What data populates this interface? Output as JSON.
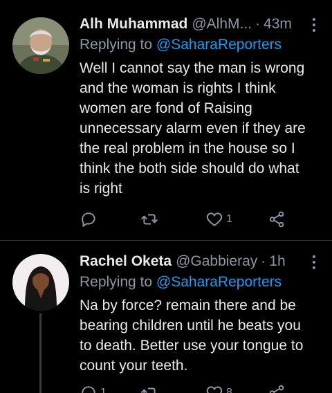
{
  "tweets": [
    {
      "name": "Alh Muhammad",
      "handle": "@AlhM...",
      "time": "43m",
      "replying_prefix": "Replying to ",
      "replying_to": "@SaharaReporters",
      "lines": [
        "Well I cannot say the man is wrong",
        "and the woman is rights I think",
        "women are fond of Raising",
        "unnecessary alarm even if they are",
        "the real problem in the house so I",
        "think the both side should do what",
        "is right"
      ],
      "reply_count": "",
      "retweet_count": "",
      "like_count": "1"
    },
    {
      "name": "Rachel Oketa",
      "handle": "@Gabbieray",
      "time": "1h",
      "replying_prefix": "Replying to ",
      "replying_to": "@SaharaReporters",
      "lines": [
        "Na by force? remain there and be",
        "bearing children until he beats you",
        "to death. Better use your tongue to",
        "count your teeth."
      ],
      "reply_count": "1",
      "retweet_count": "",
      "like_count": "8"
    }
  ],
  "colors": {
    "background": "#000000",
    "text": "#e7e9ea",
    "secondary": "#8b98a5",
    "mention": "#1d9bf0",
    "divider": "#2f3336"
  },
  "icons": {
    "reply": "comment-bubble-icon",
    "retweet": "retweet-icon",
    "like": "heart-icon",
    "share": "share-icon",
    "more": "more-vertical-icon"
  }
}
